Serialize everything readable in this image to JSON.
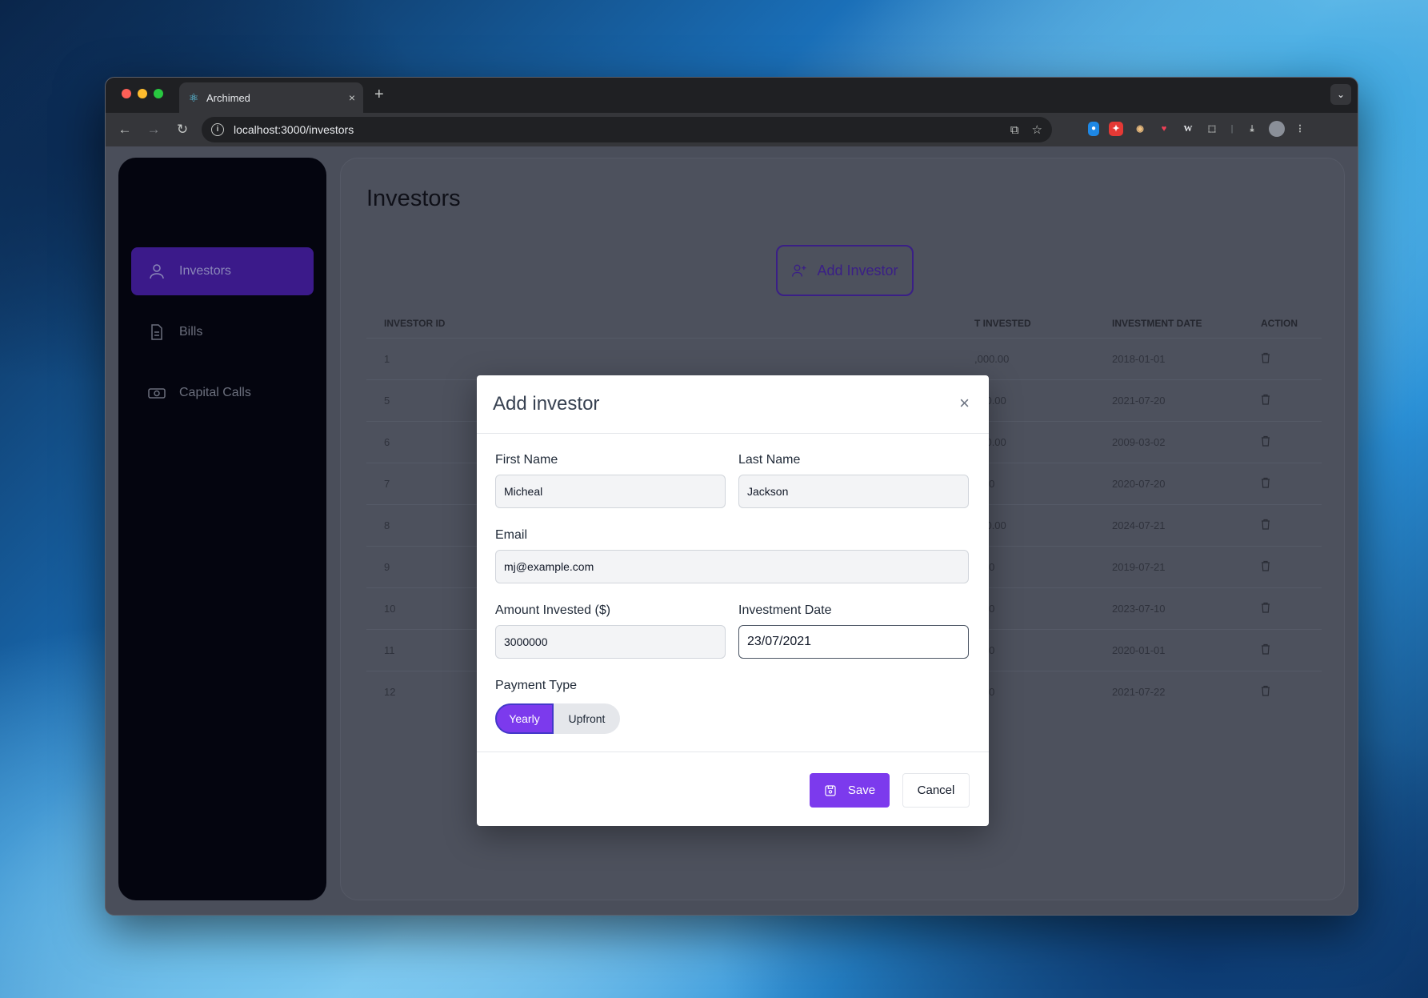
{
  "browser": {
    "tab_title": "Archimed",
    "url": "localhost:3000/investors",
    "new_tab": "+",
    "tab_close": "×"
  },
  "sidebar": {
    "items": [
      {
        "label": "Investors",
        "icon": "user-icon",
        "active": true
      },
      {
        "label": "Bills",
        "icon": "document-icon",
        "active": false
      },
      {
        "label": "Capital Calls",
        "icon": "cash-icon",
        "active": false
      }
    ]
  },
  "page": {
    "title": "Investors",
    "add_button": "Add Investor"
  },
  "table": {
    "headers": [
      "INVESTOR ID",
      "T INVESTED",
      "INVESTMENT DATE",
      "ACTION"
    ],
    "rows": [
      {
        "id": "1",
        "invested": ",000.00",
        "date": "2018-01-01"
      },
      {
        "id": "5",
        "invested": "000.00",
        "date": "2021-07-20"
      },
      {
        "id": "6",
        "invested": "000.00",
        "date": "2009-03-02"
      },
      {
        "id": "7",
        "invested": "0.00",
        "date": "2020-07-20"
      },
      {
        "id": "8",
        "invested": "000.00",
        "date": "2024-07-21"
      },
      {
        "id": "9",
        "invested": "0.00",
        "date": "2019-07-21"
      },
      {
        "id": "10",
        "invested": "0.00",
        "date": "2023-07-10"
      },
      {
        "id": "11",
        "invested": "0.00",
        "date": "2020-01-01"
      },
      {
        "id": "12",
        "invested": "0.00",
        "date": "2021-07-22"
      }
    ]
  },
  "modal": {
    "title": "Add investor",
    "close": "×",
    "first_name_label": "First Name",
    "first_name_value": "Micheal",
    "last_name_label": "Last Name",
    "last_name_value": "Jackson",
    "email_label": "Email",
    "email_value": "mj@example.com",
    "amount_label": "Amount Invested ($)",
    "amount_value": "3000000",
    "date_label": "Investment Date",
    "date_value": "23/07/2021",
    "payment_label": "Payment Type",
    "payment_options": [
      "Yearly",
      "Upfront"
    ],
    "save": "Save",
    "cancel": "Cancel"
  },
  "colors": {
    "accent": "#7c3aed",
    "sidebar_active": "#3b1a8a",
    "sidebar_bg": "#04050f"
  }
}
